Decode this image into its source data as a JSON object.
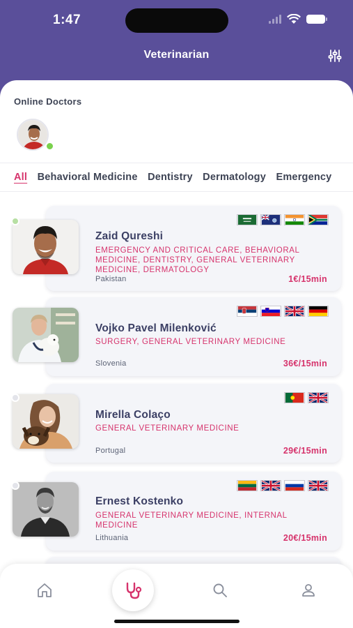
{
  "status_bar": {
    "time": "1:47"
  },
  "header": {
    "title": "Veterinarian",
    "filter_icon": "sliders-icon"
  },
  "online_section": {
    "title": "Online Doctors",
    "status_color": "#7ad14d"
  },
  "filter_tabs": [
    {
      "label": "All",
      "active": true
    },
    {
      "label": "Behavioral Medicine",
      "active": false
    },
    {
      "label": "Dentistry",
      "active": false
    },
    {
      "label": "Dermatology",
      "active": false
    },
    {
      "label": "Emergency",
      "active": false
    }
  ],
  "doctors": [
    {
      "name": "Zaid Qureshi",
      "specialties": "EMERGENCY AND CRITICAL CARE, BEHAVIORAL MEDICINE, DENTISTRY, GENERAL VETERINARY MEDICINE, DERMATOLOGY",
      "country": "Pakistan",
      "price": "1€/15min",
      "flags": [
        "saudi-arabia-flag",
        "falklands-flag",
        "india-flag",
        "south-africa-flag"
      ],
      "online": true
    },
    {
      "name": "Vojko Pavel Milenković",
      "specialties": "SURGERY, GENERAL VETERINARY MEDICINE",
      "country": "Slovenia",
      "price": "36€/15min",
      "flags": [
        "serbia-flag",
        "slovenia-flag",
        "uk-flag",
        "germany-flag"
      ],
      "online": false
    },
    {
      "name": "Mirella Colaço",
      "specialties": "GENERAL VETERINARY MEDICINE",
      "country": "Portugal",
      "price": "29€/15min",
      "flags": [
        "portugal-flag",
        "uk-flag"
      ],
      "online": false
    },
    {
      "name": "Ernest Kostenko",
      "specialties": "GENERAL VETERINARY MEDICINE, INTERNAL MEDICINE",
      "country": "Lithuania",
      "price": "20€/15min",
      "flags": [
        "lithuania-flag",
        "uk-flag",
        "russia-flag",
        "uk-flag"
      ],
      "online": false
    }
  ],
  "tabbar": {
    "items": [
      "home-icon",
      "stethoscope-icon",
      "search-icon",
      "profile-icon"
    ],
    "active": "stethoscope-icon"
  },
  "colors": {
    "brand": "#5a4f9a",
    "accent": "#d6336c",
    "name": "#3b3f64"
  }
}
